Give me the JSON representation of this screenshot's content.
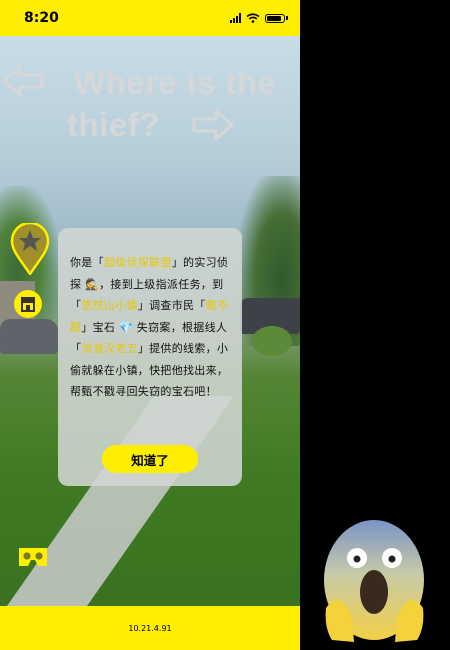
{
  "status_bar": {
    "time": "8:20"
  },
  "title": {
    "line1": "Where is the",
    "line2": "thief?"
  },
  "dialog": {
    "segments": [
      {
        "text": "你是「",
        "hl": false
      },
      {
        "text": "超级侦探联盟",
        "hl": true
      },
      {
        "text": "」的实习侦探 🕵️，接到上级指派任务，到「",
        "hl": false
      },
      {
        "text": "悠然山小镇",
        "hl": true
      },
      {
        "text": "」调查市民「",
        "hl": false
      },
      {
        "text": "甄不戳",
        "hl": true
      },
      {
        "text": "」宝石 💎 失窃案，根据线人「",
        "hl": false
      },
      {
        "text": "流浪汉老五",
        "hl": true
      },
      {
        "text": "」提供的线索，小偷就躲在小镇，快把他找出来，帮甄不戳寻回失窃的宝石吧！",
        "hl": false
      }
    ],
    "button_label": "知道了"
  },
  "footer": {
    "version": "10.21.4.91"
  },
  "icons": {
    "back": "left-arrow-icon",
    "next": "right-arrow-icon",
    "map_pin": "map-pin-icon",
    "shop": "shop-icon",
    "vr": "vr-headset-icon",
    "emoji": "screaming-face-emoji"
  },
  "colors": {
    "accent": "#ffee00",
    "highlight": "#e6c800"
  }
}
